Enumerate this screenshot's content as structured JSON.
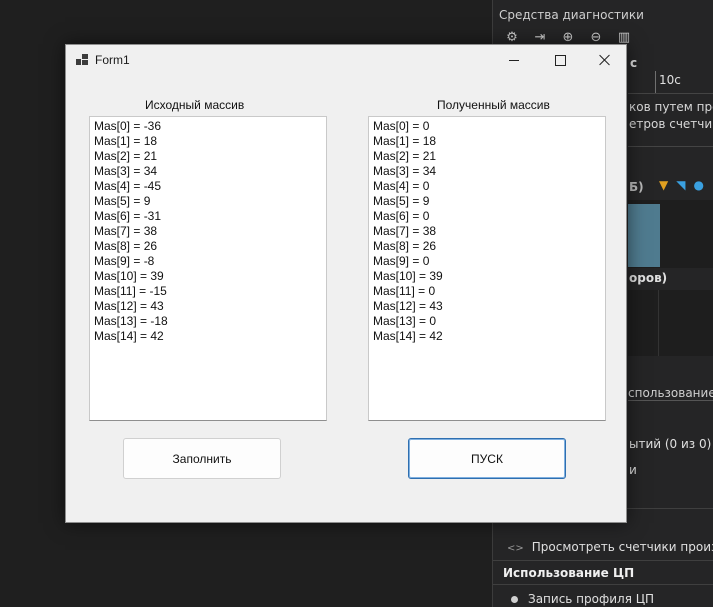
{
  "diagnostics": {
    "title": "Средства диагностики",
    "toolbar_icons": [
      "settings-icon",
      "export-icon",
      "zoom-in-icon",
      "zoom-out-icon",
      "chart-icon"
    ],
    "timeline_fragment": "с",
    "timeline_tick": "10с",
    "fragment_1": "ков путем прове",
    "fragment_2": "етров счетчика",
    "fragment_3": "Б)",
    "fragment_4": "оров)",
    "fragment_5": "спользование па",
    "fragment_6": "ытий (0 из 0)",
    "fragment_7": "и",
    "counters_row": "Просмотреть счетчики производ",
    "cpu_section": "Использование ЦП",
    "cpu_record": "Запись профиля ЦП",
    "colors": {
      "bar": "#4f7b8f",
      "marker_orange": "#e0a020",
      "marker_blue": "#3aa0e0"
    }
  },
  "window": {
    "title": "Form1",
    "labels": {
      "source": "Исходный массив",
      "result": "Полученный массив"
    },
    "source_items": [
      "Mas[0] = -36",
      "Mas[1] = 18",
      "Mas[2] = 21",
      "Mas[3] = 34",
      "Mas[4] = -45",
      "Mas[5] = 9",
      "Mas[6] = -31",
      "Mas[7] = 38",
      "Mas[8] = 26",
      "Mas[9] = -8",
      "Mas[10] = 39",
      "Mas[11] = -15",
      "Mas[12] = 43",
      "Mas[13] = -18",
      "Mas[14] = 42"
    ],
    "result_items": [
      "Mas[0] = 0",
      "Mas[1] = 18",
      "Mas[2] = 21",
      "Mas[3] = 34",
      "Mas[4] = 0",
      "Mas[5] = 9",
      "Mas[6] = 0",
      "Mas[7] = 38",
      "Mas[8] = 26",
      "Mas[9] = 0",
      "Mas[10] = 39",
      "Mas[11] = 0",
      "Mas[12] = 43",
      "Mas[13] = 0",
      "Mas[14] = 42"
    ],
    "buttons": {
      "fill": "Заполнить",
      "run": "ПУСК"
    }
  }
}
